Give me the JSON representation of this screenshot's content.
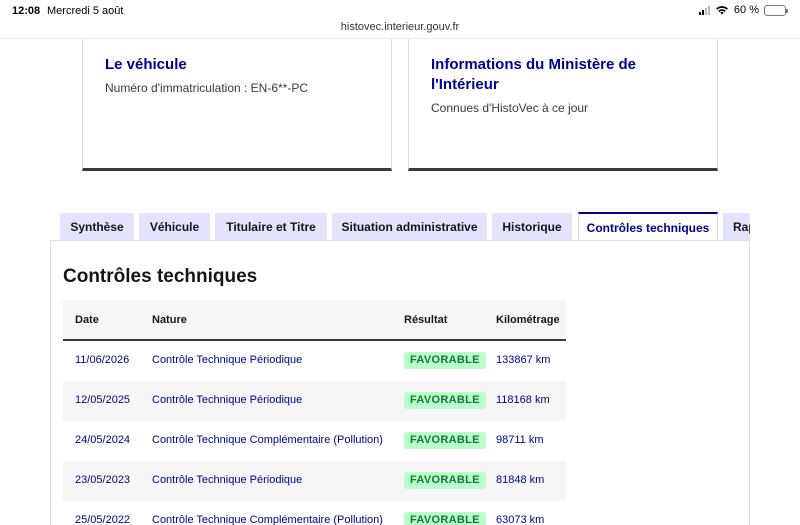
{
  "status_bar": {
    "time": "12:08",
    "date": "Mercredi 5 août",
    "battery": "60 %",
    "battery_level": 0.6
  },
  "browser": {
    "url": "histovec.interieur.gouv.fr"
  },
  "cards": [
    {
      "title": "Le véhicule",
      "text": "Numéro d'immatriculation : EN-6**-PC"
    },
    {
      "title": "Informations du Ministère de l'Intérieur",
      "text": "Connues d'HistoVec à ce jour"
    }
  ],
  "tabs": [
    {
      "label": "Synthèse"
    },
    {
      "label": "Véhicule"
    },
    {
      "label": "Titulaire et Titre"
    },
    {
      "label": "Situation administrative"
    },
    {
      "label": "Historique"
    },
    {
      "label": "Contrôles techniques",
      "active": true
    },
    {
      "label": "Rapport"
    }
  ],
  "section": {
    "title": "Contrôles techniques"
  },
  "table": {
    "headers": [
      "Date",
      "Nature",
      "Résultat",
      "Kilométrage"
    ],
    "rows": [
      [
        "11/06/2026",
        "Contrôle Technique Périodique",
        "FAVORABLE",
        "133867 km"
      ],
      [
        "12/05/2025",
        "Contrôle Technique Périodique",
        "FAVORABLE",
        "118168 km"
      ],
      [
        "24/05/2024",
        "Contrôle Technique Complémentaire (Pollution)",
        "FAVORABLE",
        "98711 km"
      ],
      [
        "23/05/2023",
        "Contrôle Technique Périodique",
        "FAVORABLE",
        "81848 km"
      ],
      [
        "25/05/2022",
        "Contrôle Technique Complémentaire (Pollution)",
        "FAVORABLE",
        "63073 km"
      ]
    ]
  },
  "colors": {
    "primary": "#000091",
    "tab_background": "#e3e3fd",
    "badge_background": "#b8fec9",
    "badge_text": "#18753c"
  }
}
